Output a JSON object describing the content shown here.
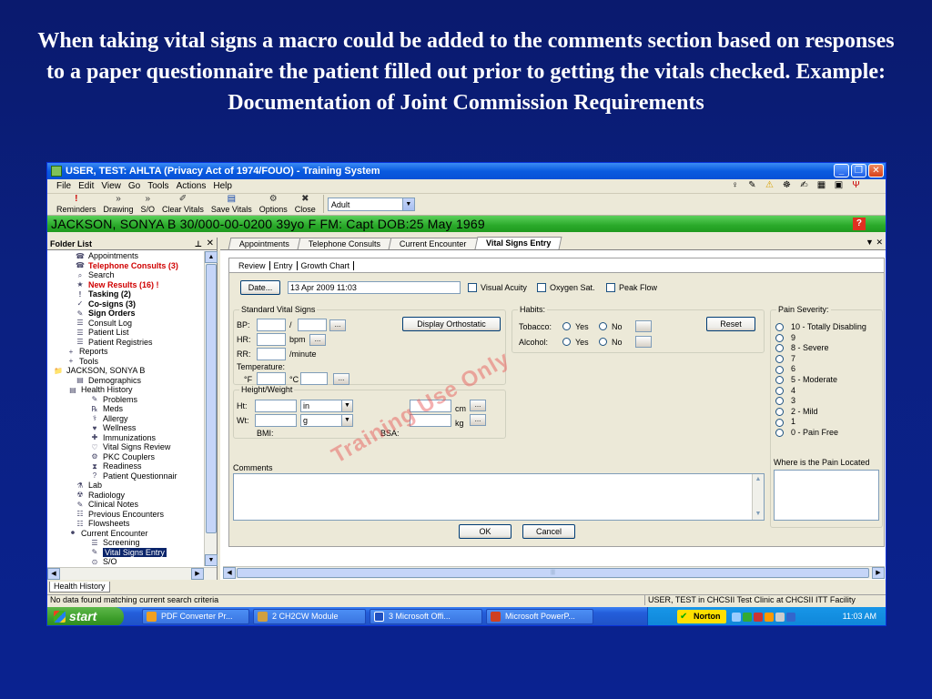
{
  "slide": {
    "title": "When taking vital signs a macro could be added to the comments section based on responses to a paper questionnaire the patient filled out prior to getting the vitals checked.  Example: Documentation of Joint Commission Requirements"
  },
  "window": {
    "title": "USER, TEST: AHLTA  (Privacy Act of 1974/FOUO) -  Training System",
    "buttons": [
      "_",
      "❐",
      "✕"
    ]
  },
  "menu": [
    "File",
    "Edit",
    "View",
    "Go",
    "Tools",
    "Actions",
    "Help"
  ],
  "toolbar": {
    "buttons": [
      "Reminders",
      "Drawing",
      "S/O",
      "Clear Vitals",
      "Save Vitals",
      "Options",
      "Close"
    ],
    "combo_value": "Adult"
  },
  "patient_bar": "JACKSON, SONYA B  30/000-00-0200  39yo  F    FM: Capt  DOB:25 May 1969",
  "folder_list": {
    "title": "Folder List",
    "items": [
      {
        "label": "Appointments",
        "style": "",
        "indent": 30
      },
      {
        "label": "Telephone Consults (3)",
        "style": "red",
        "indent": 30
      },
      {
        "label": "Search",
        "style": "",
        "indent": 30
      },
      {
        "label": "New Results (16) !",
        "style": "red",
        "indent": 30
      },
      {
        "label": "Tasking (2)",
        "style": "bold",
        "indent": 30
      },
      {
        "label": "Co-signs (3)",
        "style": "bold",
        "indent": 30
      },
      {
        "label": "Sign Orders",
        "style": "bold",
        "indent": 30
      },
      {
        "label": "Consult Log",
        "style": "",
        "indent": 30
      },
      {
        "label": "Patient List",
        "style": "",
        "indent": 30
      },
      {
        "label": "Patient Registries",
        "style": "",
        "indent": 30
      },
      {
        "label": "Reports",
        "style": "",
        "indent": 20
      },
      {
        "label": "Tools",
        "style": "",
        "indent": 20
      },
      {
        "label": "JACKSON, SONYA B",
        "style": "",
        "indent": 6
      },
      {
        "label": "Demographics",
        "style": "",
        "indent": 30
      },
      {
        "label": "Health History",
        "style": "",
        "indent": 22
      },
      {
        "label": "Problems",
        "style": "",
        "indent": 46
      },
      {
        "label": "Meds",
        "style": "",
        "indent": 46
      },
      {
        "label": "Allergy",
        "style": "",
        "indent": 46
      },
      {
        "label": "Wellness",
        "style": "",
        "indent": 46
      },
      {
        "label": "Immunizations",
        "style": "",
        "indent": 46
      },
      {
        "label": "Vital Signs Review",
        "style": "",
        "indent": 46
      },
      {
        "label": "PKC Couplers",
        "style": "",
        "indent": 46
      },
      {
        "label": "Readiness",
        "style": "",
        "indent": 46
      },
      {
        "label": "Patient Questionnair",
        "style": "",
        "indent": 46
      },
      {
        "label": "Lab",
        "style": "",
        "indent": 30
      },
      {
        "label": "Radiology",
        "style": "",
        "indent": 30
      },
      {
        "label": "Clinical Notes",
        "style": "",
        "indent": 30
      },
      {
        "label": "Previous Encounters",
        "style": "",
        "indent": 30
      },
      {
        "label": "Flowsheets",
        "style": "",
        "indent": 30
      },
      {
        "label": "Current Encounter",
        "style": "",
        "indent": 22
      },
      {
        "label": "Screening",
        "style": "",
        "indent": 46
      },
      {
        "label": "Vital Signs Entry",
        "style": "sel",
        "indent": 46
      },
      {
        "label": "S/O",
        "style": "",
        "indent": 46
      }
    ]
  },
  "tabs": [
    "Appointments",
    "Telephone Consults",
    "Current Encounter",
    "Vital Signs Entry"
  ],
  "sub_tabs": [
    "Review",
    "Entry",
    "Growth Chart"
  ],
  "form": {
    "date_button": "Date...",
    "date_value": "13 Apr 2009 11:03",
    "checks": [
      "Visual Acuity",
      "Oxygen Sat.",
      "Peak Flow"
    ],
    "std_vitals_title": "Standard Vital Signs",
    "bp_label": "BP:",
    "bp_sep": "/",
    "hr_label": "HR:",
    "hr_unit": "bpm",
    "rr_label": "RR:",
    "rr_unit": "/minute",
    "temp_label": "Temperature:",
    "temp_f": "°F",
    "temp_c": "°C",
    "display_orthostatic": "Display Orthostatic",
    "habits_title": "Habits:",
    "tobacco_label": "Tobacco:",
    "alcohol_label": "Alcohol:",
    "yes": "Yes",
    "no": "No",
    "reset": "Reset",
    "hw_title": "Height/Weight",
    "ht_label": "Ht:",
    "ht_unit": "in",
    "wt_label": "Wt:",
    "wt_unit": "g",
    "cm": "cm",
    "kg": "kg",
    "bmi": "BMI:",
    "bsa": "BSA:",
    "comments": "Comments",
    "ok": "OK",
    "cancel": "Cancel",
    "ellipsis": "...",
    "watermark": "Training Use Only"
  },
  "pain": {
    "title": "Pain Severity:",
    "levels": [
      "10 - Totally Disabling",
      "9",
      "8  - Severe",
      "7",
      "6",
      "5  - Moderate",
      "4",
      "3",
      "2   - Mild",
      "1",
      "0 - Pain Free"
    ],
    "location_label": "Where is the Pain Located"
  },
  "bottom_tab": "Health History",
  "status": {
    "left": "No data found matching current search criteria",
    "right": "USER, TEST in CHCSII Test Clinic at CHCSII ITT Facility"
  },
  "taskbar": {
    "start": "start",
    "tasks": [
      "PDF Converter Pr...",
      "2 CH2CW  Module",
      "3 Microsoft Offi...",
      "Microsoft PowerP..."
    ],
    "norton": "Norton",
    "clock": "11:03 AM"
  }
}
